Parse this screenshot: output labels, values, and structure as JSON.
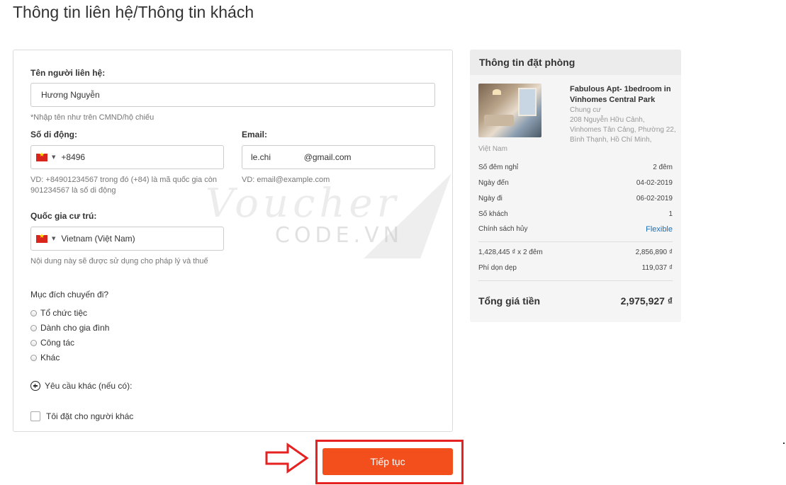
{
  "page": {
    "title": "Thông tin liên hệ/Thông tin khách"
  },
  "form": {
    "contact_name": {
      "label": "Tên người liên hệ:",
      "value": "Hương Nguyễn",
      "hint": "*Nhập tên như trên CMND/hộ chiếu"
    },
    "phone": {
      "label": "Số di động:",
      "value": "+8496",
      "hint": "VD: +84901234567 trong đó (+84) là mã quốc gia còn 901234567 là số di động"
    },
    "email": {
      "label": "Email:",
      "value": "le.chi              @gmail.com",
      "hint": "VD: email@example.com"
    },
    "country": {
      "label": "Quốc gia cư trú:",
      "value": "Vietnam (Việt Nam)",
      "hint": "Nội dung này sẽ được sử dụng cho pháp lý và thuế"
    },
    "purpose": {
      "label": "Mục đích chuyến đi?",
      "options": [
        "Tổ chức tiệc",
        "Dành cho gia đình",
        "Công tác",
        "Khác"
      ]
    },
    "other_requests": "Yêu cầu khác (nếu có):",
    "book_for_other": "Tôi đặt cho người khác"
  },
  "summary": {
    "title": "Thông tin đặt phòng",
    "hotel_name": "Fabulous Apt- 1bedroom in Vinhomes Central Park",
    "hotel_type": "Chung cư",
    "hotel_address": "208 Nguyễn Hữu Cảnh, Vinhomes Tân Cảng, Phường 22, Bình Thạnh, Hồ Chí Minh,",
    "hotel_country": "Việt Nam",
    "rows": [
      {
        "label": "Số đêm nghỉ",
        "value": "2  đêm"
      },
      {
        "label": "Ngày đến",
        "value": "04-02-2019"
      },
      {
        "label": "Ngày đi",
        "value": "06-02-2019"
      },
      {
        "label": "Số khách",
        "value": "1"
      },
      {
        "label": "Chính sách hủy",
        "value": "Flexible"
      }
    ],
    "price_rows": [
      {
        "label": "1,428,445 ₫ x 2  đêm",
        "value": "2,856,890 ₫"
      },
      {
        "label": "Phí dọn dẹp",
        "value": "119,037 ₫"
      }
    ],
    "total_label": "Tổng giá tiền",
    "total_value": "2,975,927 ₫"
  },
  "watermark": {
    "script": "Voucher",
    "code": "CODE.VN"
  },
  "actions": {
    "continue_label": "Tiếp tục"
  },
  "colors": {
    "accent": "#f34f1c",
    "highlight": "#e52121",
    "link": "#1a6fb8"
  }
}
